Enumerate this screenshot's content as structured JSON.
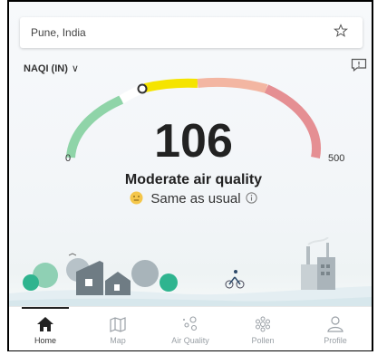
{
  "search": {
    "location": "Pune, India"
  },
  "scale": {
    "label": "NAQI (IN)",
    "chevron": "∨"
  },
  "gauge": {
    "min_label": "0",
    "max_label": "500",
    "value": 106,
    "max": 500
  },
  "aqi": {
    "value": "106",
    "quality": "Moderate air quality",
    "trend": "Same as usual"
  },
  "colors": {
    "good": "#8fd4a8",
    "moderate": "#f5e400",
    "poor": "#f3b6a2",
    "severe": "#e58f93"
  },
  "nav": {
    "items": [
      {
        "label": "Home",
        "icon": "home-icon"
      },
      {
        "label": "Map",
        "icon": "map-icon"
      },
      {
        "label": "Air Quality",
        "icon": "air-quality-icon"
      },
      {
        "label": "Pollen",
        "icon": "pollen-icon"
      },
      {
        "label": "Profile",
        "icon": "profile-icon"
      }
    ]
  }
}
